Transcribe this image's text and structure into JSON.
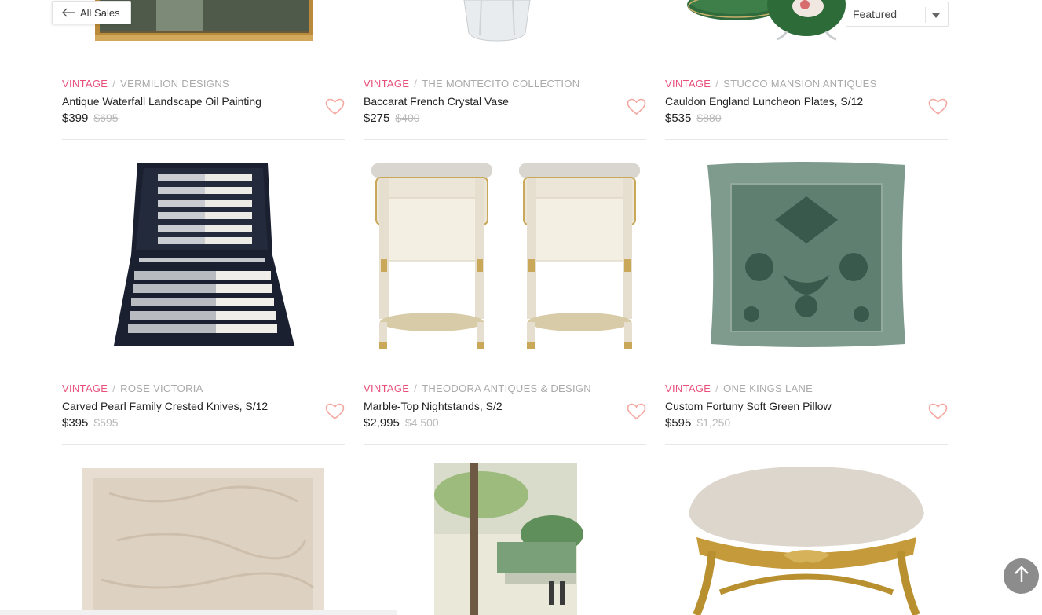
{
  "nav": {
    "back_label": "All Sales"
  },
  "sort": {
    "selected": "Featured"
  },
  "colors": {
    "accent": "#e8507a",
    "heart": "#f4a7a0"
  },
  "products": [
    {
      "condition": "VINTAGE",
      "seller": "VERMILION DESIGNS",
      "title": "Antique Waterfall Landscape Oil Painting",
      "price": "$399",
      "original_price": "$695"
    },
    {
      "condition": "VINTAGE",
      "seller": "THE MONTECITO COLLECTION",
      "title": "Baccarat French Crystal Vase",
      "price": "$275",
      "original_price": "$400"
    },
    {
      "condition": "VINTAGE",
      "seller": "STUCCO MANSION ANTIQUES",
      "title": "Cauldon England Luncheon Plates, S/12",
      "price": "$535",
      "original_price": "$880"
    },
    {
      "condition": "VINTAGE",
      "seller": "ROSE VICTORIA",
      "title": "Carved Pearl Family Crested Knives, S/12",
      "price": "$395",
      "original_price": "$595"
    },
    {
      "condition": "VINTAGE",
      "seller": "THEODORA ANTIQUES & DESIGN",
      "title": "Marble-Top Nightstands, S/2",
      "price": "$2,995",
      "original_price": "$4,500"
    },
    {
      "condition": "VINTAGE",
      "seller": "ONE KINGS LANE",
      "title": "Custom Fortuny Soft Green Pillow",
      "price": "$595",
      "original_price": "$1,250"
    }
  ],
  "scroll_to_top": {
    "icon": "arrow-up-icon"
  }
}
